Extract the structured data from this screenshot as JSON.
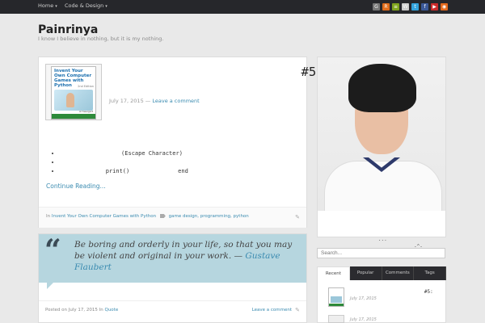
{
  "nav": {
    "items": [
      {
        "label": "Home"
      },
      {
        "label": "Code & Design"
      }
    ],
    "social_icons": [
      {
        "name": "github-icon",
        "color": "#777777",
        "glyph": "G"
      },
      {
        "name": "reddit-icon",
        "color": "#e06c1a",
        "glyph": "R"
      },
      {
        "name": "feed-icon",
        "color": "#7fa31d",
        "glyph": "≡"
      },
      {
        "name": "wordpress-icon",
        "color": "#cccccc",
        "glyph": "W"
      },
      {
        "name": "twitter-icon",
        "color": "#33a3dc",
        "glyph": "t"
      },
      {
        "name": "facebook-icon",
        "color": "#3b5998",
        "glyph": "f"
      },
      {
        "name": "youtube-icon",
        "color": "#cc2b2b",
        "glyph": "▶"
      },
      {
        "name": "rss-icon",
        "color": "#e36a1d",
        "glyph": "◉"
      }
    ]
  },
  "site": {
    "title": "Painrinya",
    "description": "I know I believe in nothing, but it is my nothing."
  },
  "post1": {
    "title_line1": "ᅟᅟᅟᅟᅟᅟᅟᅟᅟᅟᅟᅟᅟᅟᅟᅟ #5:",
    "title_line2": "ᅟᅟᅟᅟᅟᅟᅟᅟ",
    "date": "July 17, 2015",
    "date_sep": "—",
    "comment_link": "Leave a comment",
    "excerpt_heading": "ᅟᅟᅟᅟᅟᅟᅟᅟᅟᅟᅟᅟ",
    "bullets": [
      "ᅟᅟᅟᅟᅟᅟᅟᅟᅟᅟᅟ (Escape Character)",
      "ᅟᅟᅟᅟᅟᅟᅟᅟᅟᅟᅟᅟᅟᅟᅟᅟᅟᅟᅟᅟᅟ ᅟᅟᅟᅟᅟᅟ",
      "ᅟᅟᅟᅟᅟᅟᅟᅟ print() ᅟᅟᅟᅟᅟᅟᅟᅟ end ᅟᅟᅟᅟᅟᅟᅟᅟᅟᅟᅟᅟᅟᅟᅟᅟ"
    ],
    "continue_label": "Continue Reading...",
    "footer_in": "In",
    "category": "Invent Your Own Computer Games with Python",
    "tags": "game design, programming, python",
    "book": {
      "title": "Invent Your Own Computer Games with Python",
      "edition": "2nd Edition",
      "author": "Al Sweigart"
    }
  },
  "post2": {
    "quote": "Be boring and orderly in your life, so that you may be violent and original in your work. —",
    "quote_author": "Gustave Flaubert",
    "posted_on": "Posted on",
    "date": "July 17, 2015",
    "in_label": "In",
    "category": "Quote",
    "comment_link": "Leave a comment"
  },
  "sidebar": {
    "bio": "ᅟᅟᅟᅟᅟᅟᅟᅟᅟᅟ ᅟᅟᅟᅟ ᅟᅟᅟᅟᅟᅟᅟᅟᅟᅟᅟᅟᅟᅟ ᅟᅟᅟᅟᅟᅟᅟᅟ ᅟᅟᅟᅟᅟᅟᅟᅟᅟᅟᅟᅟᅟᅟᅟᅟᅟᅟᅟᅟᅟᅟᅟᅟ ᅟᅟᅟᅟᅟᅟᅟᅟᅟᅟᅟᅟ ...ᅟᅟᅟᅟᅟᅟᅟᅟᅟ ᅟᅟᅟᅟᅟᅟᅟᅟᅟᅟᅟᅟᅟᅟᅟᅟᅟᅟᅟᅟ -^-",
    "search_placeholder": "Search...",
    "tabs": [
      {
        "label": "Recent"
      },
      {
        "label": "Popular"
      },
      {
        "label": "Comments"
      },
      {
        "label": "Tags"
      }
    ],
    "recent": [
      {
        "title": "ᅟᅟᅟᅟᅟᅟᅟᅟᅟᅟᅟᅟᅟᅟᅟᅟ #5: ᅟᅟᅟᅟᅟᅟᅟᅟ",
        "date": "July 17, 2015"
      },
      {
        "date": "July 17, 2015"
      }
    ]
  }
}
